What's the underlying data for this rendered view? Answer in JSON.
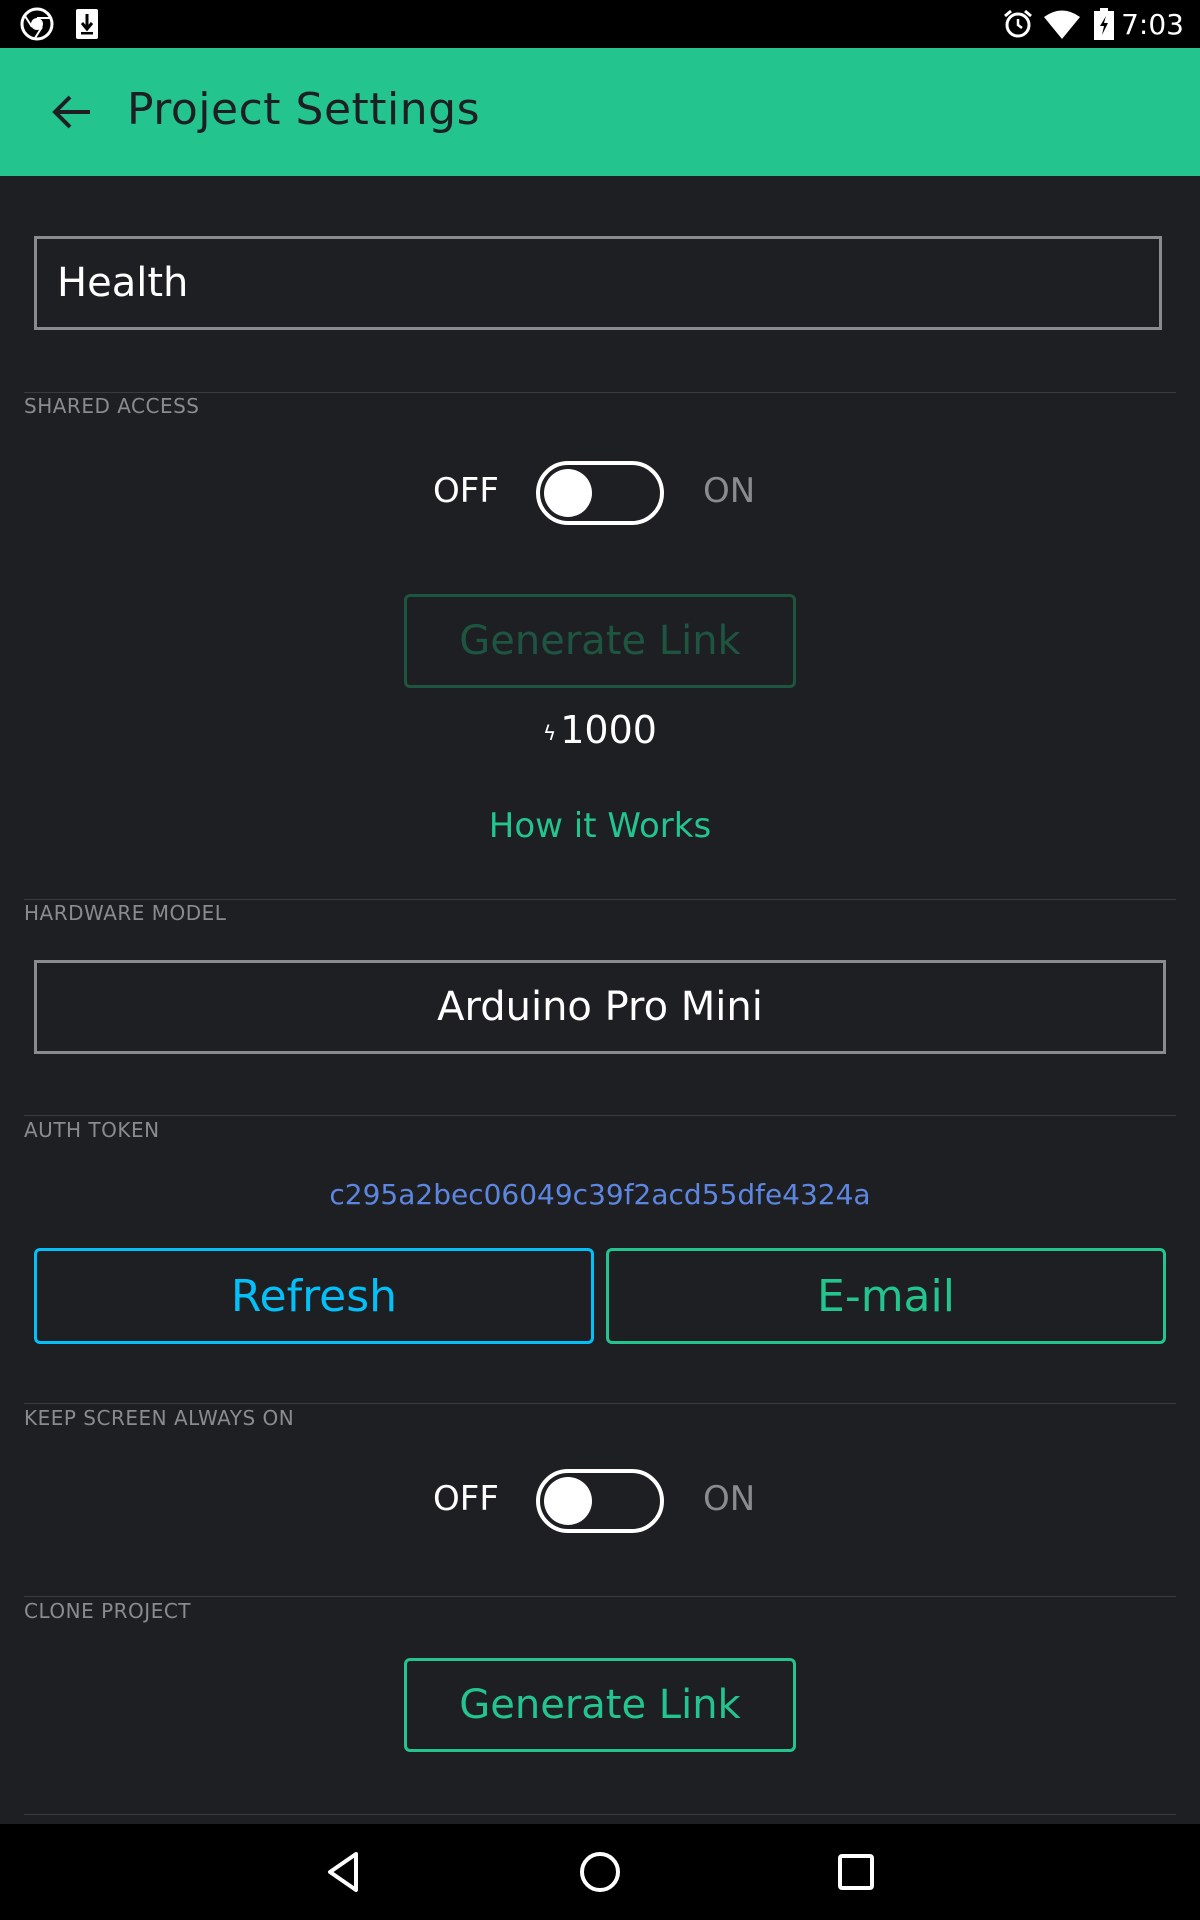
{
  "status_bar": {
    "left_icons": [
      "chrome-icon",
      "download-icon"
    ],
    "right_icons": [
      "alarm-icon",
      "wifi-icon",
      "battery-icon"
    ],
    "time": "7:03"
  },
  "app_bar": {
    "title": "Project Settings",
    "background": "#23c48e"
  },
  "project_name": {
    "value": "Health"
  },
  "shared_access": {
    "label": "SHARED ACCESS",
    "toggle_off_label": "OFF",
    "toggle_on_label": "ON",
    "toggle_state": "OFF",
    "generate_link_label": "Generate Link",
    "energy_icon": "lightning-bolt",
    "energy_value": "1000",
    "how_it_works_label": "How it Works"
  },
  "hardware_model": {
    "label": "HARDWARE MODEL",
    "selected": "Arduino Pro Mini"
  },
  "auth_token": {
    "label": "AUTH TOKEN",
    "token": "c295a2bec06049c39f2acd55dfe4324a",
    "refresh_label": "Refresh",
    "email_label": "E-mail"
  },
  "keep_screen_on": {
    "label": "KEEP SCREEN ALWAYS ON",
    "toggle_off_label": "OFF",
    "toggle_on_label": "ON",
    "toggle_state": "OFF"
  },
  "clone_project": {
    "label": "CLONE PROJECT",
    "generate_link_label": "Generate Link"
  },
  "nav_bar": {
    "icons": [
      "back-icon",
      "home-icon",
      "recents-icon"
    ]
  },
  "colors": {
    "accent_green": "#23c48e",
    "accent_blue": "#04c0f8",
    "token_color": "#5d86e0",
    "background": "#1e1f23"
  }
}
